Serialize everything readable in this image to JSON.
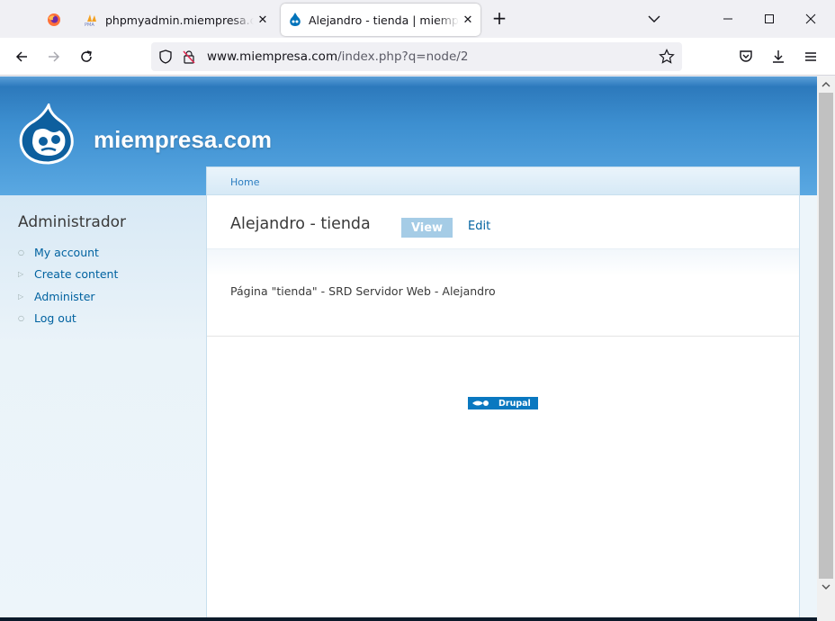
{
  "browser": {
    "tabs": [
      {
        "title": "phpmyadmin.miempresa.com",
        "favicon": "pma-icon"
      },
      {
        "title": "Alejandro - tienda | miempresa.com",
        "favicon": "drupal-icon"
      }
    ],
    "url_domain": "www.miempresa.com",
    "url_path": "/index.php?q=node/2"
  },
  "site": {
    "name": "miempresa.com"
  },
  "sidebar": {
    "title": "Administrador",
    "items": [
      {
        "label": "My account"
      },
      {
        "label": "Create content"
      },
      {
        "label": "Administer"
      },
      {
        "label": "Log out"
      }
    ]
  },
  "content": {
    "breadcrumb": "Home",
    "node_title": "Alejandro - tienda",
    "tab_view": "View",
    "tab_edit": "Edit",
    "body": "Página \"tienda\" - SRD Servidor Web - Alejandro",
    "powered_by": "Drupal"
  }
}
